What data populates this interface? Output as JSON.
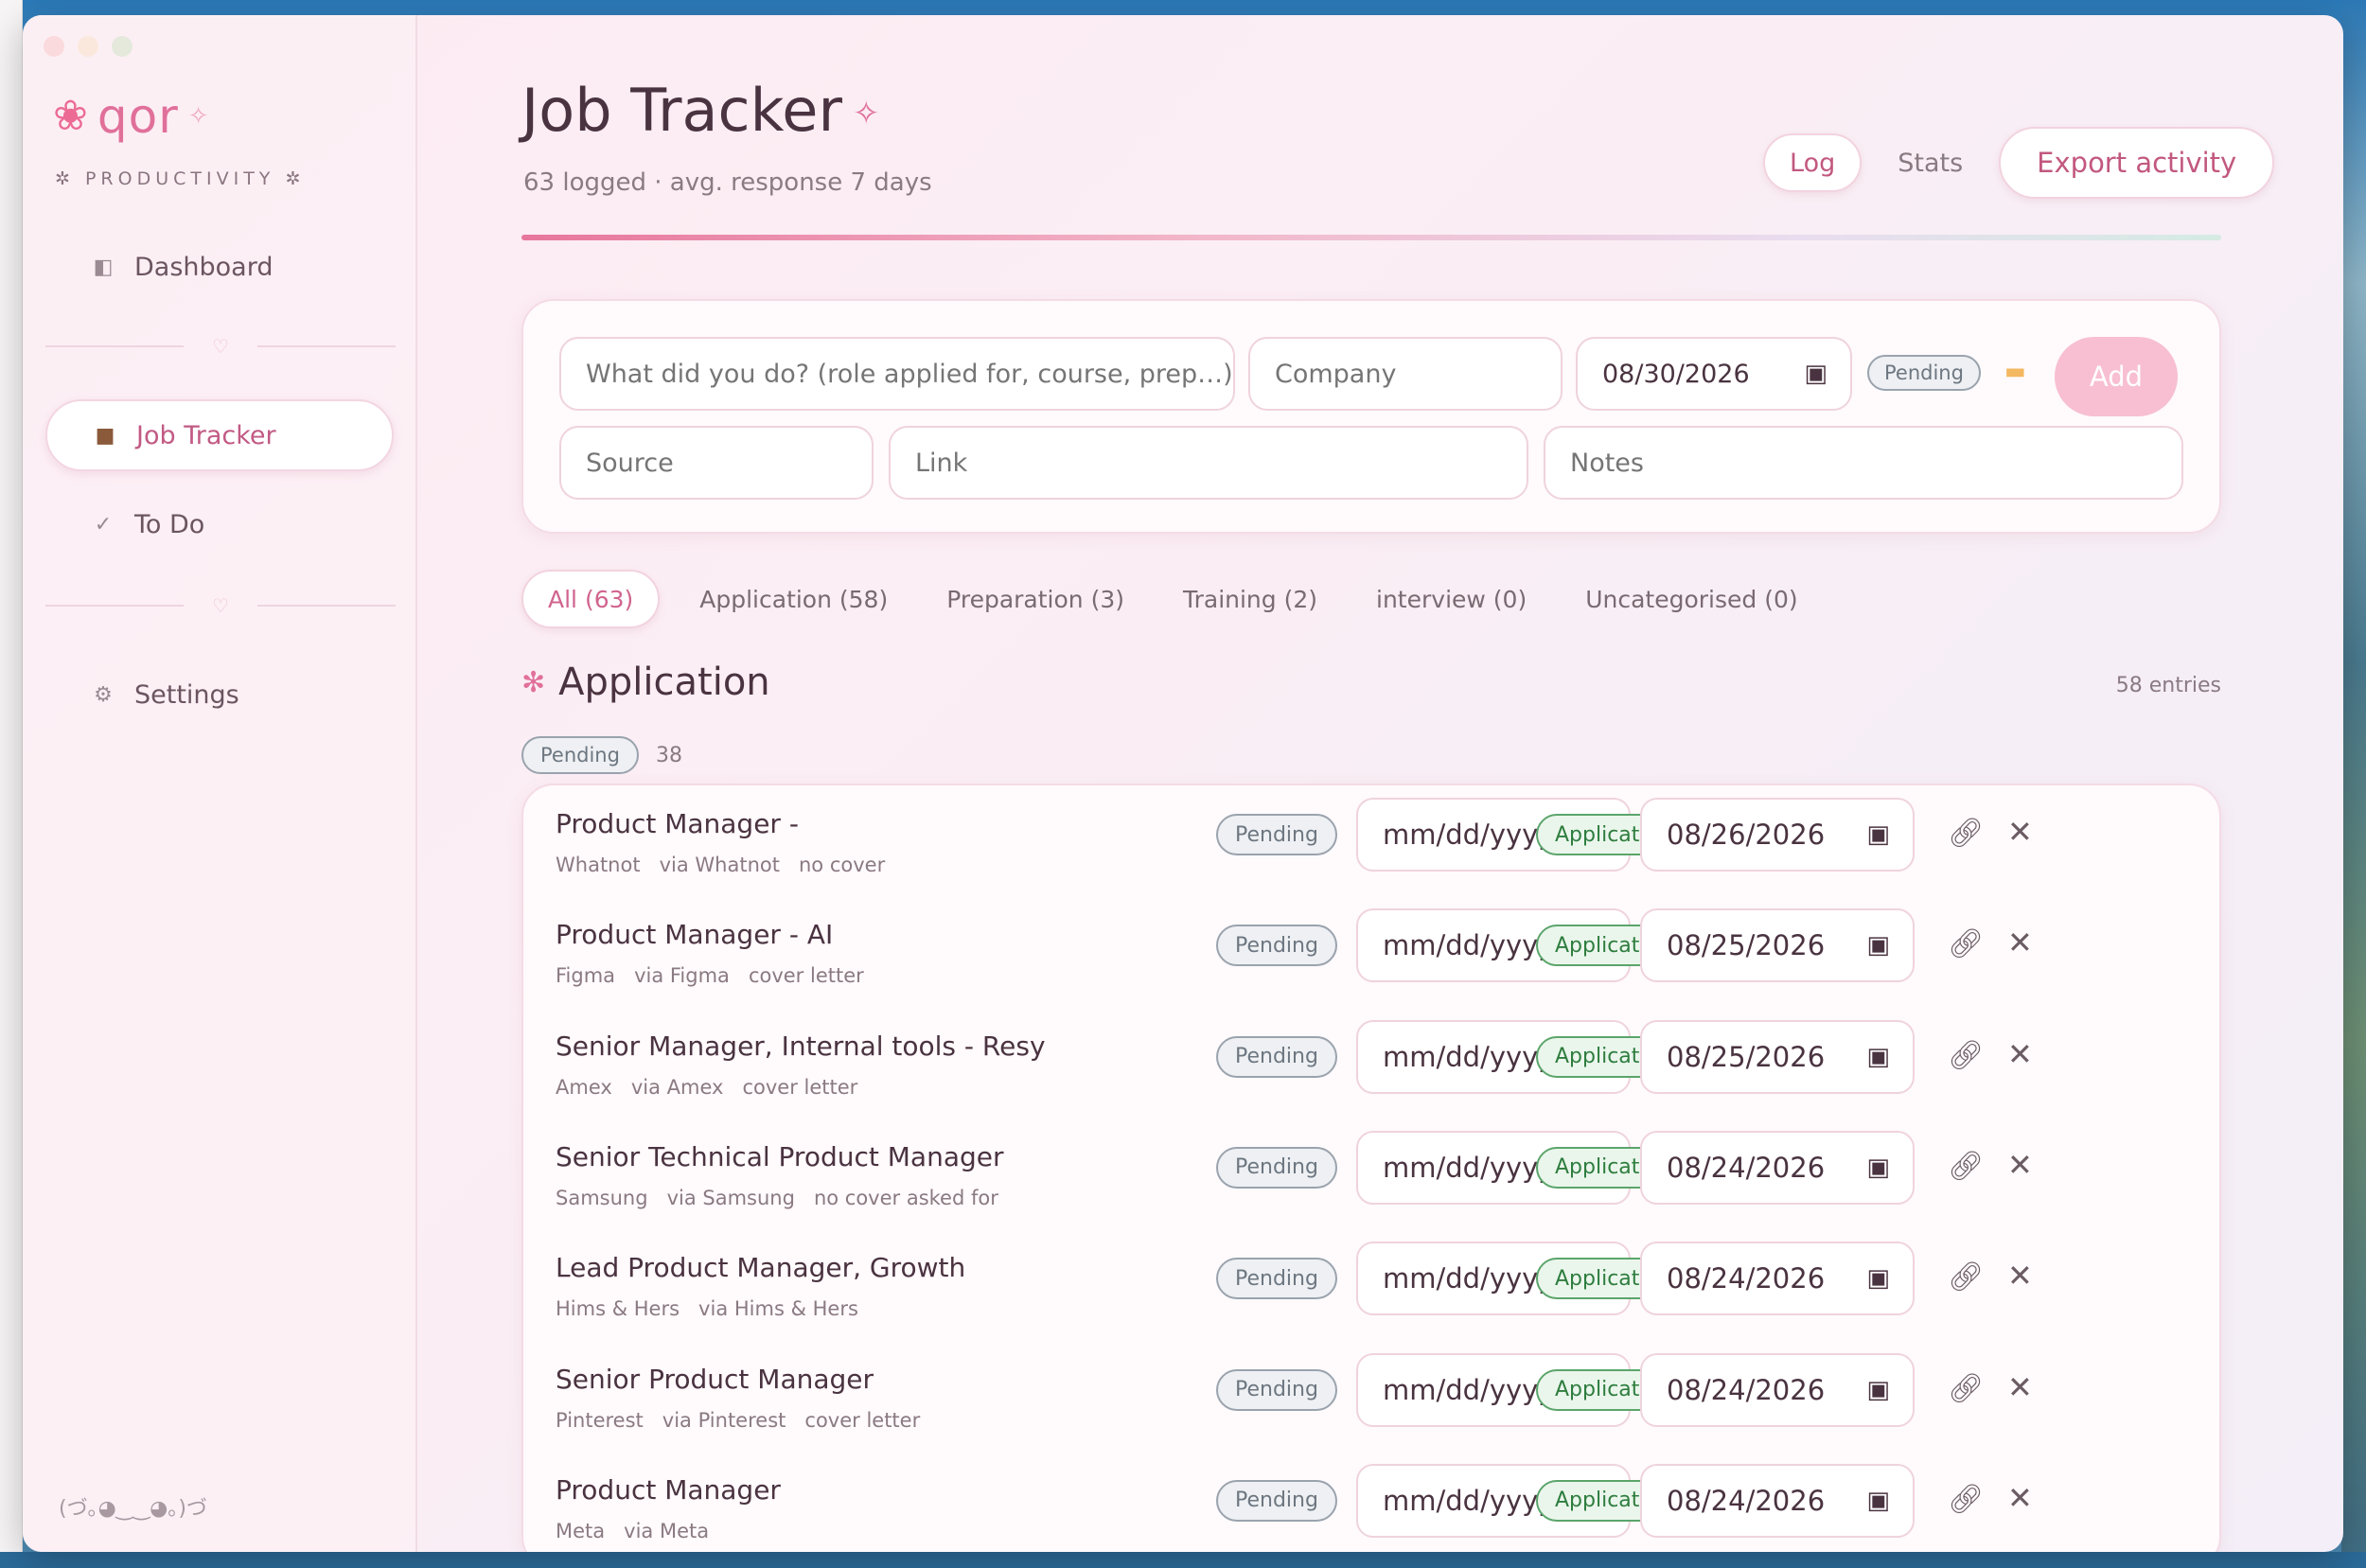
{
  "app": {
    "brand_name": "qor",
    "brand_sub": "✲ PRODUCTIVITY ✲",
    "kaomoji": "(づ｡◕‿‿◕｡)づ"
  },
  "sidebar": {
    "items": [
      {
        "label": "Dashboard",
        "icon": "sidebar-icon"
      },
      {
        "label": "Job Tracker",
        "icon": "briefcase-icon",
        "active": true
      },
      {
        "label": "To Do",
        "icon": "check-icon"
      },
      {
        "label": "Settings",
        "icon": "gear-icon"
      }
    ]
  },
  "header": {
    "title": "Job Tracker",
    "subtitle": "63 logged · avg. response 7 days",
    "actions": {
      "log": "Log",
      "stats": "Stats",
      "export": "Export activity"
    }
  },
  "form": {
    "what_placeholder": "What did you do? (role applied for, course, prep…)",
    "company_placeholder": "Company",
    "date_value": "08/30/2026",
    "status": "Pending",
    "add_label": "Add",
    "source_placeholder": "Source",
    "link_placeholder": "Link",
    "notes_placeholder": "Notes"
  },
  "tabs": [
    {
      "label": "All (63)",
      "active": true
    },
    {
      "label": "Application (58)"
    },
    {
      "label": "Preparation (3)"
    },
    {
      "label": "Training (2)"
    },
    {
      "label": "interview (0)"
    },
    {
      "label": "Uncategorised (0)"
    }
  ],
  "section": {
    "title": "Application",
    "entries": "58 entries",
    "group_status": "Pending",
    "group_count": "38"
  },
  "rows": [
    {
      "title": "Product Manager -",
      "meta": "Whatnot   via Whatnot   no cover",
      "status": "Pending",
      "response_date": "mm/dd/yyyy",
      "category": "Application",
      "date": "08/26/2026"
    },
    {
      "title": "Product Manager - AI",
      "meta": "Figma   via Figma   cover letter",
      "status": "Pending",
      "response_date": "mm/dd/yyyy",
      "category": "Application",
      "date": "08/25/2026"
    },
    {
      "title": "Senior Manager, Internal tools - Resy",
      "meta": "Amex   via Amex   cover letter",
      "status": "Pending",
      "response_date": "mm/dd/yyyy",
      "category": "Application",
      "date": "08/25/2026"
    },
    {
      "title": "Senior Technical Product Manager",
      "meta": "Samsung   via Samsung   no cover asked for",
      "status": "Pending",
      "response_date": "mm/dd/yyyy",
      "category": "Application",
      "date": "08/24/2026"
    },
    {
      "title": "Lead Product Manager, Growth",
      "meta": "Hims & Hers   via Hims & Hers",
      "status": "Pending",
      "response_date": "mm/dd/yyyy",
      "category": "Application",
      "date": "08/24/2026"
    },
    {
      "title": "Senior Product Manager",
      "meta": "Pinterest   via Pinterest   cover letter",
      "status": "Pending",
      "response_date": "mm/dd/yyyy",
      "category": "Application",
      "date": "08/24/2026"
    },
    {
      "title": "Product Manager",
      "meta": "Meta   via Meta",
      "status": "Pending",
      "response_date": "mm/dd/yyyy",
      "category": "Application",
      "date": "08/24/2026"
    }
  ],
  "colors": {
    "accent": "#e0709a",
    "pending": "#6d7781",
    "application": "#2e7d3e"
  }
}
